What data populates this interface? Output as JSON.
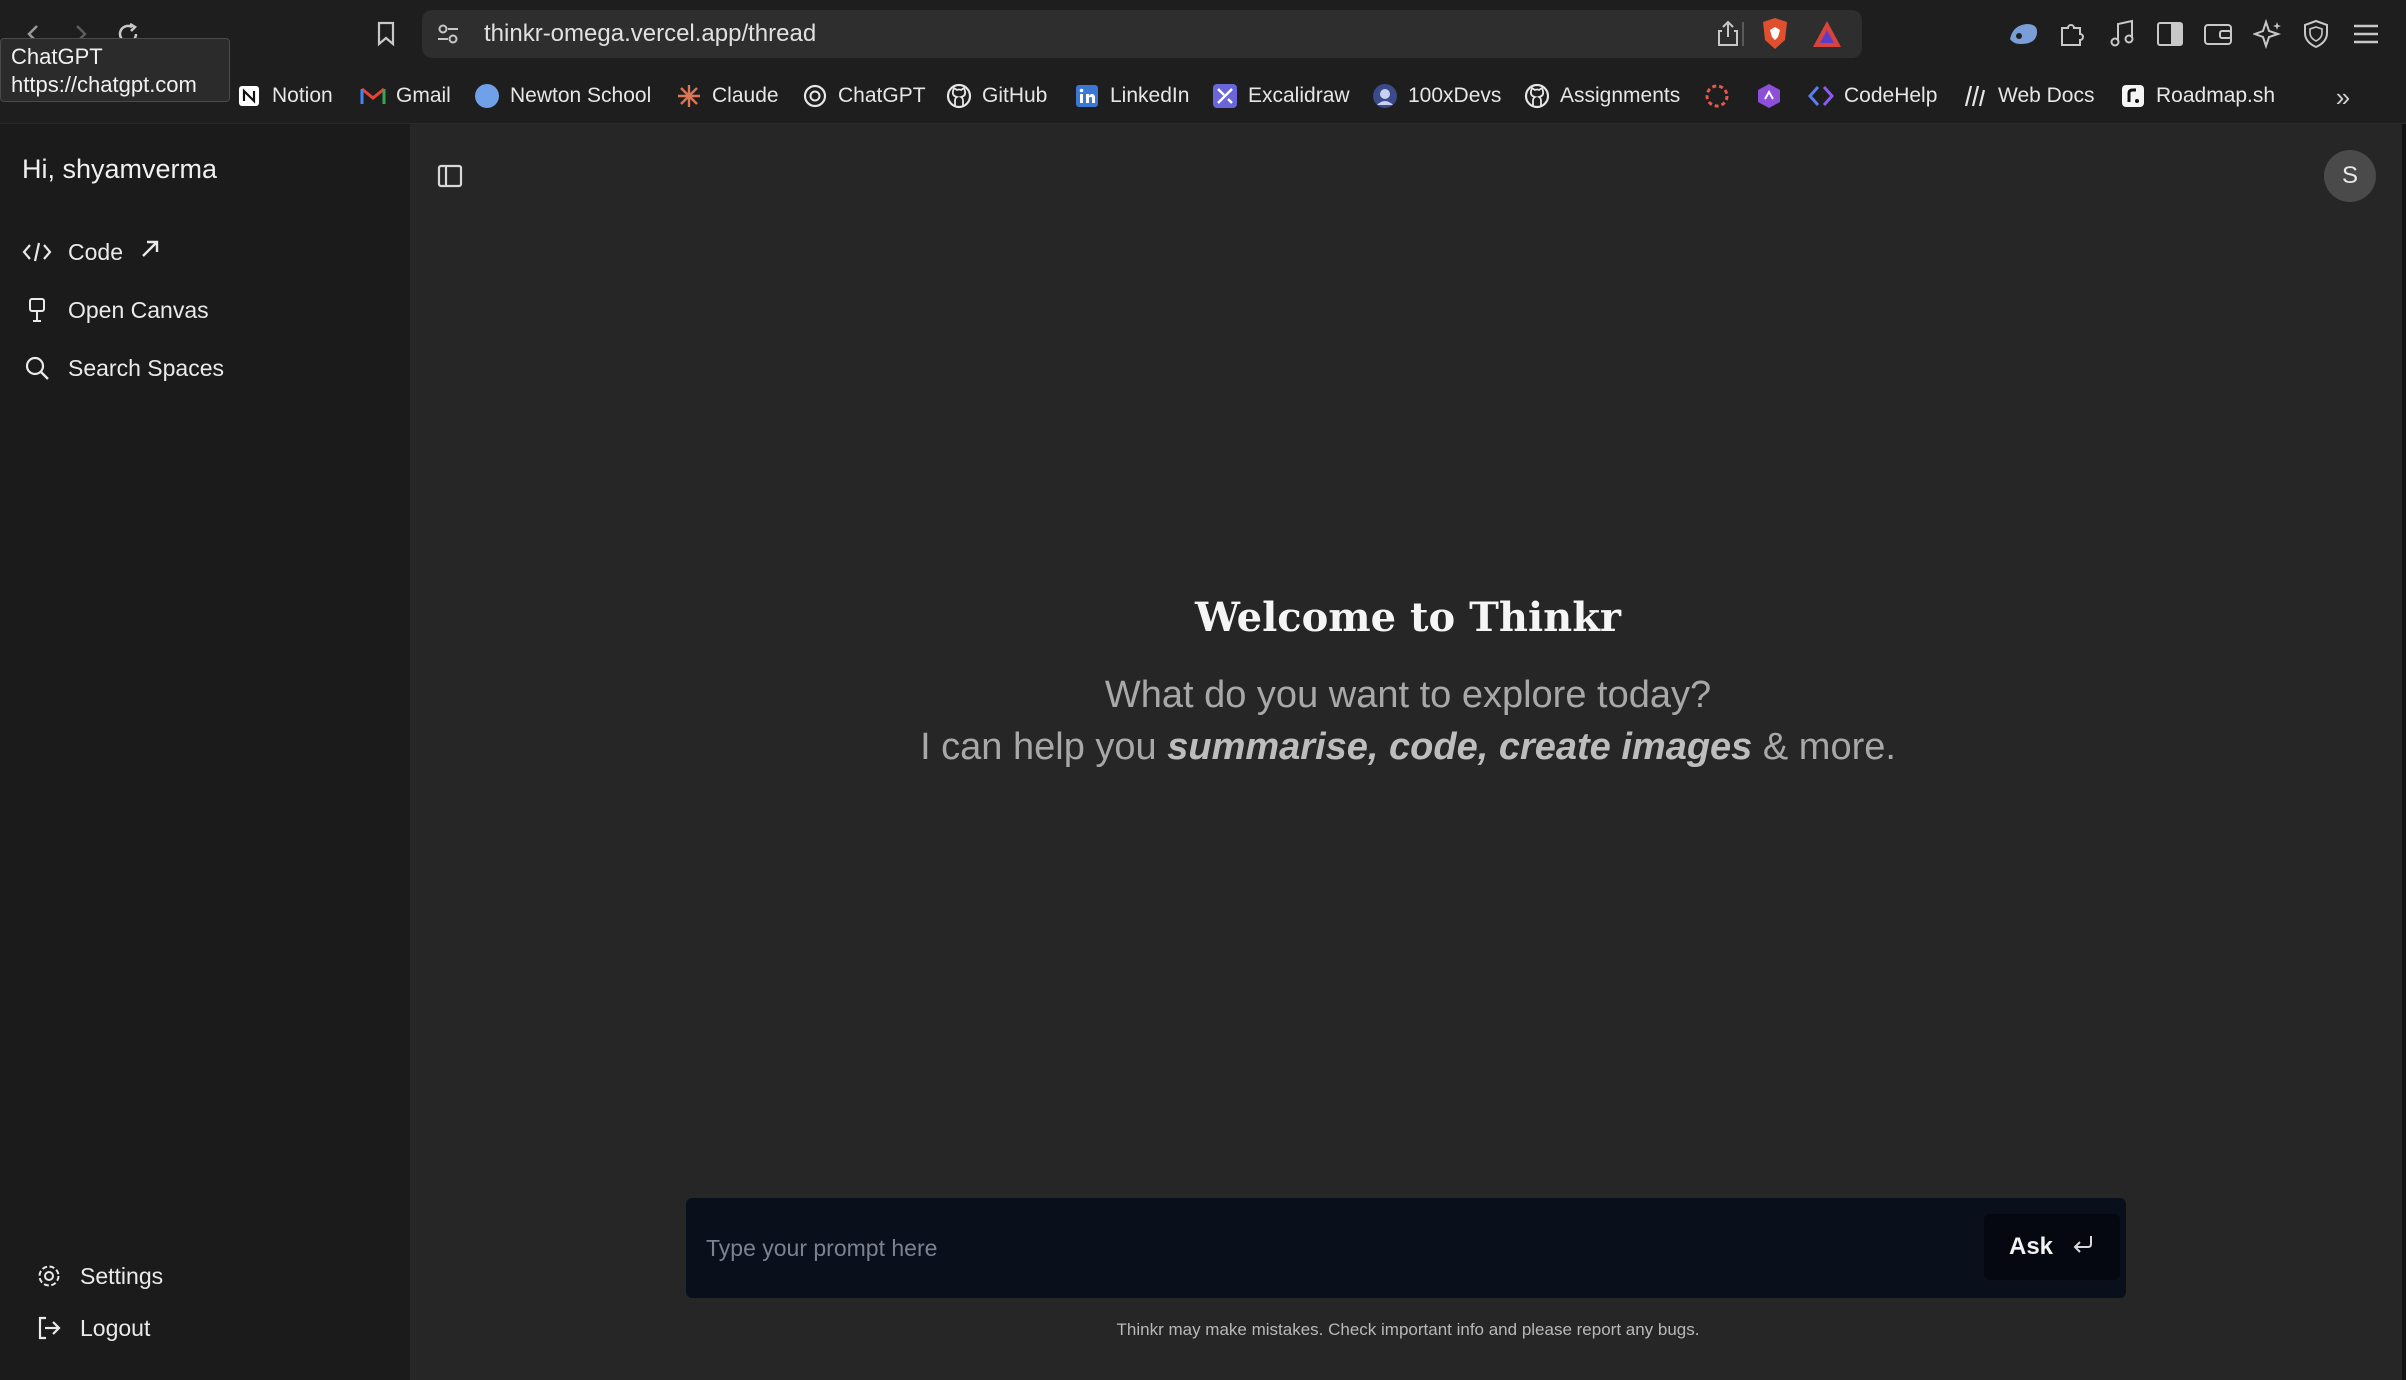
{
  "browser": {
    "url": "thinkr-omega.vercel.app/thread",
    "tooltip": {
      "title": "ChatGPT",
      "url": "https://chatgpt.com"
    },
    "bookmarks": [
      {
        "label": "Notion",
        "icon": "notion-icon"
      },
      {
        "label": "Gmail",
        "icon": "gmail-icon"
      },
      {
        "label": "Newton School",
        "icon": "newton-school-icon"
      },
      {
        "label": "Claude",
        "icon": "claude-icon"
      },
      {
        "label": "ChatGPT",
        "icon": "chatgpt-icon"
      },
      {
        "label": "GitHub",
        "icon": "github-icon"
      },
      {
        "label": "LinkedIn",
        "icon": "linkedin-icon"
      },
      {
        "label": "Excalidraw",
        "icon": "excalidraw-icon"
      },
      {
        "label": "100xDevs",
        "icon": "100xdevs-icon"
      },
      {
        "label": "Assignments",
        "icon": "github-icon"
      },
      {
        "label": "",
        "icon": "circle-dots-icon"
      },
      {
        "label": "",
        "icon": "purple-hex-icon"
      },
      {
        "label": "CodeHelp",
        "icon": "codehelp-icon"
      },
      {
        "label": "Web Docs",
        "icon": "mdn-icon"
      },
      {
        "label": "Roadmap.sh",
        "icon": "roadmap-icon"
      }
    ]
  },
  "sidebar": {
    "greeting": "Hi, shyamverma",
    "items": [
      {
        "label": "Code",
        "icon": "code-icon"
      },
      {
        "label": "Open Canvas",
        "icon": "canvas-icon"
      },
      {
        "label": "Search Spaces",
        "icon": "search-icon"
      }
    ],
    "settings_label": "Settings",
    "logout_label": "Logout"
  },
  "main": {
    "avatar_initial": "S",
    "welcome": "Welcome to Thinkr",
    "subtitle_line1": "What do you want to explore today?",
    "subtitle_line2_prefix": "I can help you ",
    "subtitle_line2_emphasis": "summarise, code, create images",
    "subtitle_line2_suffix": " & more.",
    "prompt_placeholder": "Type your prompt here",
    "prompt_value": "",
    "ask_label": "Ask",
    "disclaimer": "Thinkr may make mistakes. Check important info and please report any bugs."
  }
}
